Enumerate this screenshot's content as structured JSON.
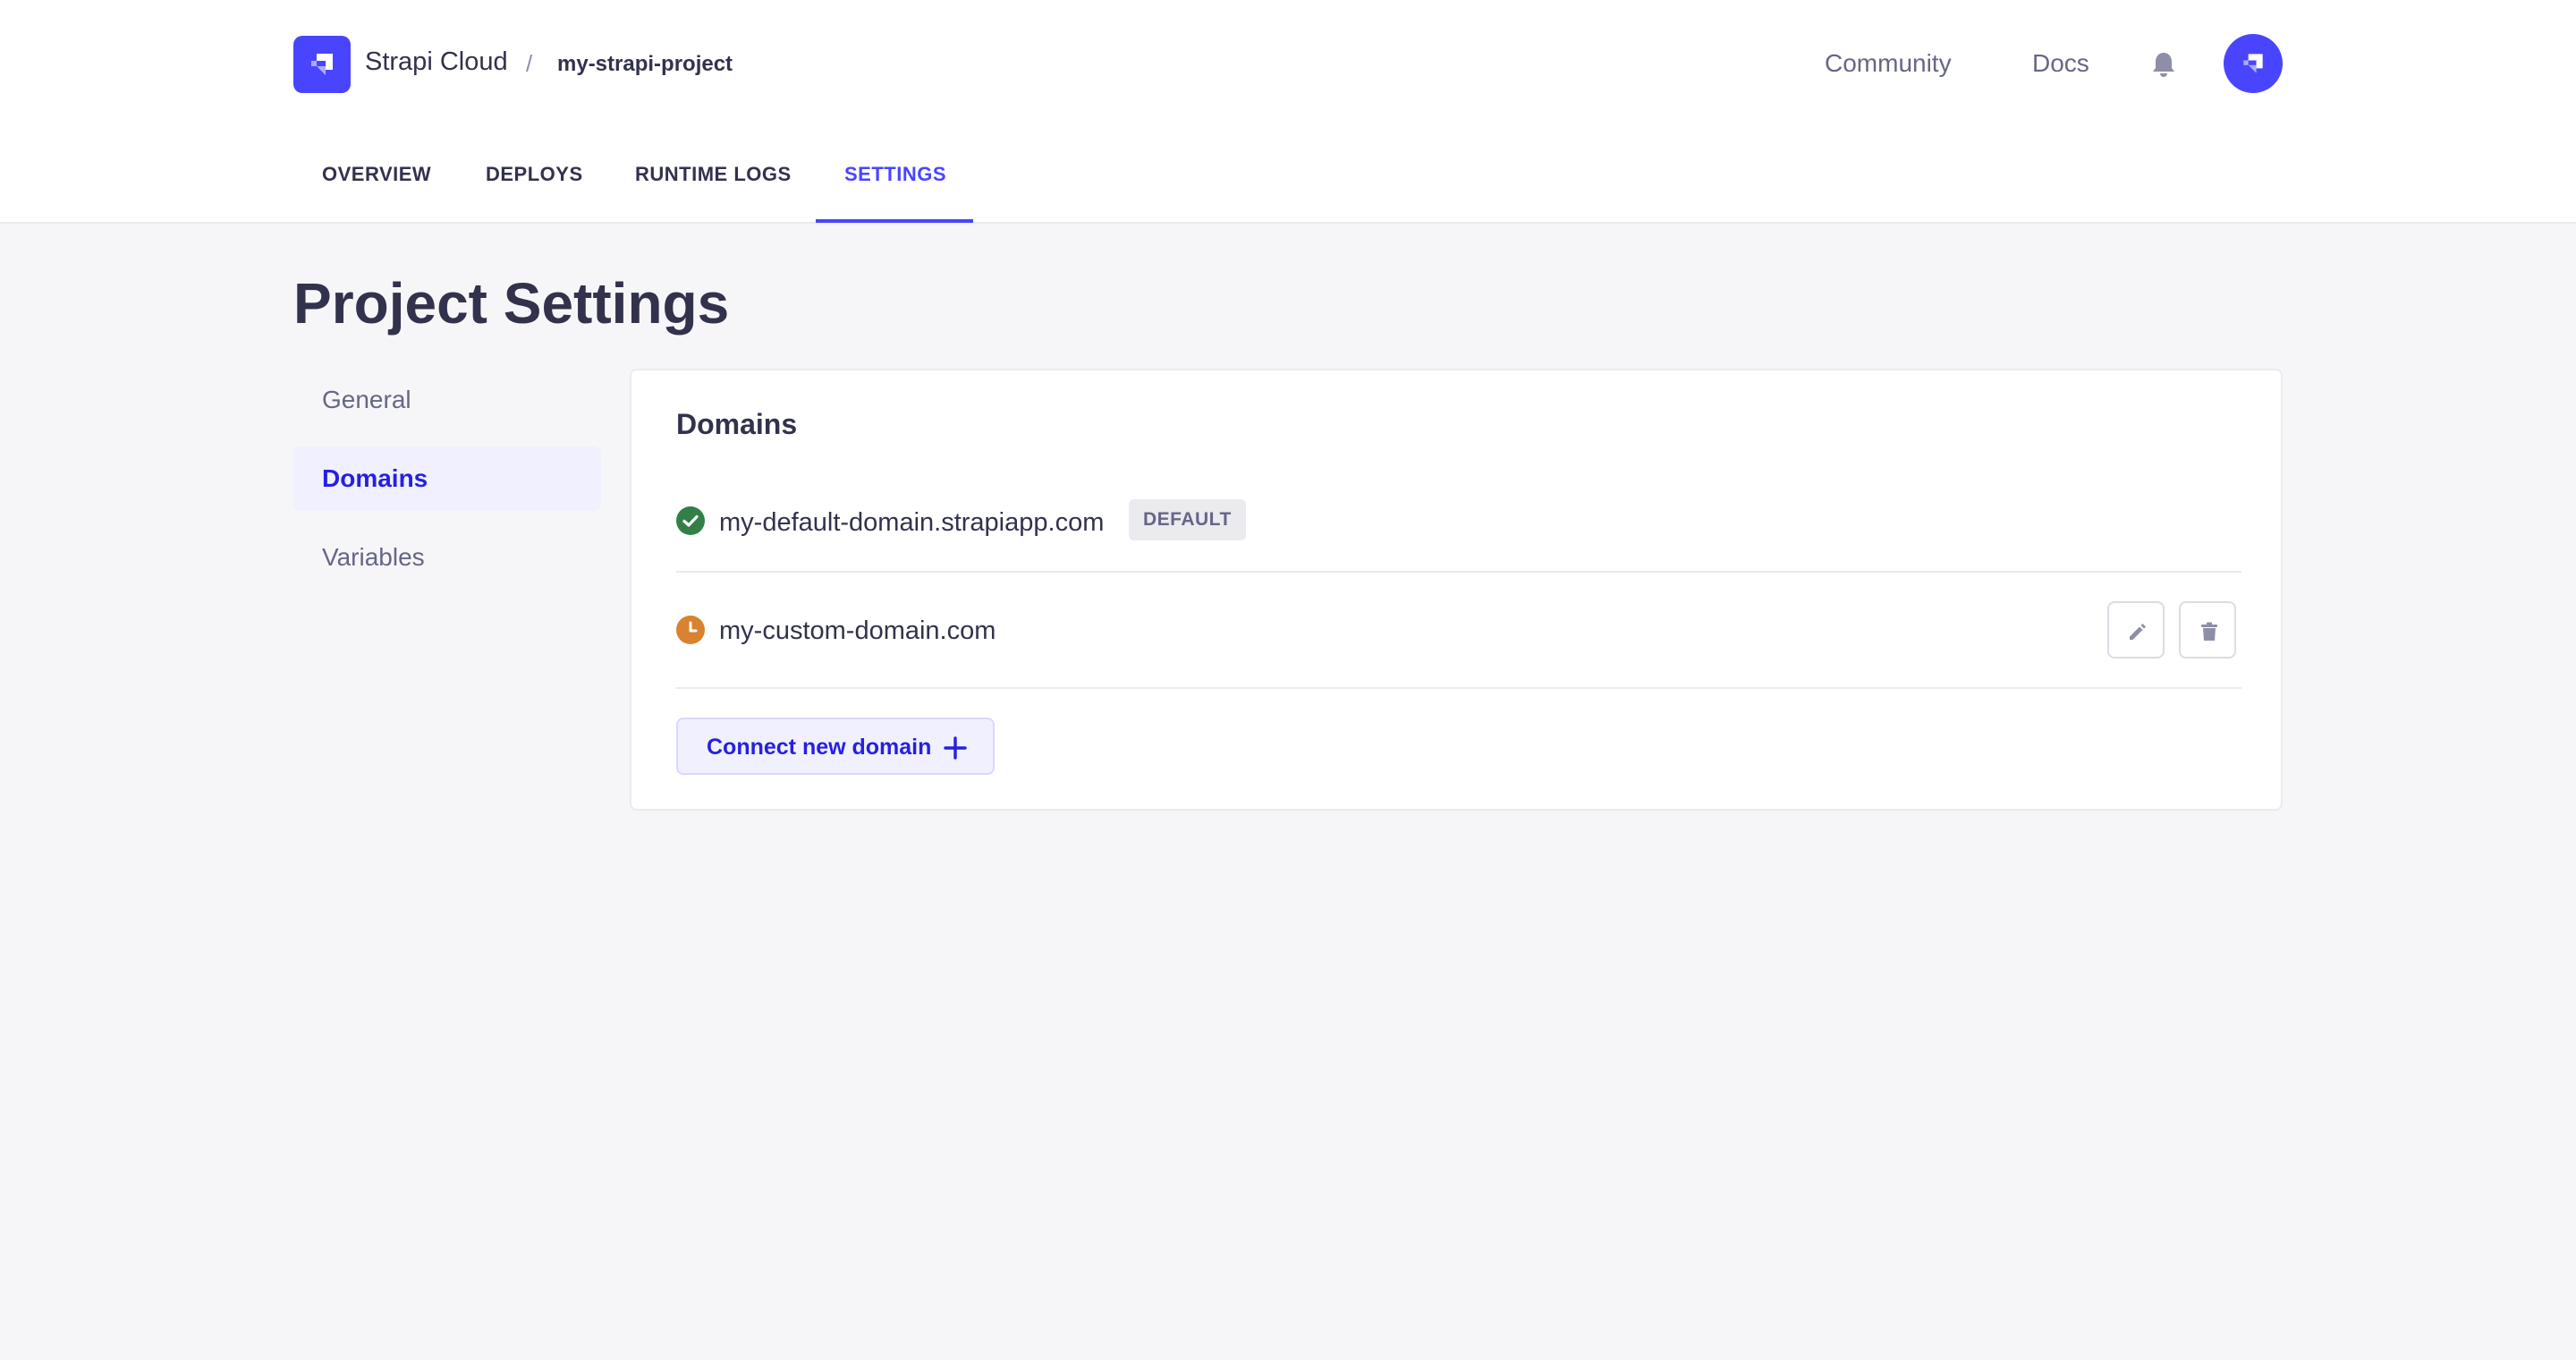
{
  "header": {
    "brand": "Strapi Cloud",
    "separator": "/",
    "project": "my-strapi-project",
    "links": {
      "community": "Community",
      "docs": "Docs"
    }
  },
  "tabs": [
    {
      "label": "OVERVIEW",
      "active": false
    },
    {
      "label": "DEPLOYS",
      "active": false
    },
    {
      "label": "RUNTIME LOGS",
      "active": false
    },
    {
      "label": "SETTINGS",
      "active": true
    }
  ],
  "page": {
    "title": "Project Settings"
  },
  "subnav": [
    {
      "label": "General",
      "active": false
    },
    {
      "label": "Domains",
      "active": true
    },
    {
      "label": "Variables",
      "active": false
    }
  ],
  "domains_card": {
    "title": "Domains",
    "domains": [
      {
        "name": "my-default-domain.strapiapp.com",
        "status": "verified",
        "badge": "DEFAULT"
      },
      {
        "name": "my-custom-domain.com",
        "status": "pending"
      }
    ],
    "connect_label": "Connect new domain"
  },
  "colors": {
    "primary": "#4945ff",
    "primary_dark": "#271fe0",
    "success": "#328048",
    "warning": "#d9822f",
    "text": "#32324d",
    "muted": "#666687"
  },
  "icons": {
    "logo": "strapi-logo-icon",
    "bell": "bell-icon",
    "verified": "check-circle-icon",
    "pending": "clock-icon",
    "edit": "pencil-icon",
    "delete": "trash-icon",
    "add": "plus-icon"
  }
}
